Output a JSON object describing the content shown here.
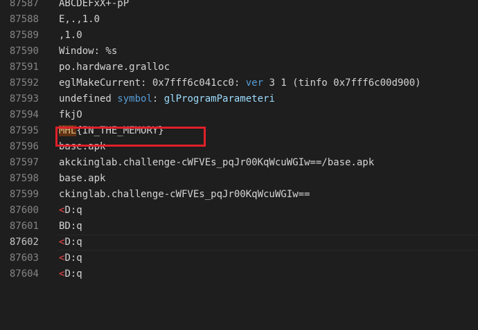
{
  "partial_top_line": "ABCDEFxX+-pP",
  "lines": [
    {
      "num": "87587",
      "text": "ABCDEFxX+-pP"
    },
    {
      "num": "87588",
      "text": "E,.,1.0"
    },
    {
      "num": "87589",
      "text": ",1.0"
    },
    {
      "num": "87590",
      "text": "Window: %s"
    },
    {
      "num": "87591",
      "text": "po.hardware.gralloc"
    },
    {
      "num": "87592",
      "pre": "eglMakeCurrent: 0x7fff6c041cc0: ",
      "kw": "ver",
      "post": " 3 1 (tinfo 0x7fff6c00d900)"
    },
    {
      "num": "87593",
      "pre": "undefined ",
      "kw": "symbol",
      "mid": ": ",
      "fn": "glProgramParameteri"
    },
    {
      "num": "87594",
      "text": "fkjO"
    },
    {
      "num": "87595",
      "hl": "MHL",
      "post": "{IN_THE_MEMORY}"
    },
    {
      "num": "87596",
      "text": "base.apk"
    },
    {
      "num": "87597",
      "text": "akckinglab.challenge-cWFVEs_pqJr00KqWcuWGIw==/base.apk"
    },
    {
      "num": "87598",
      "text": "base.apk"
    },
    {
      "num": "87599",
      "text": "ckinglab.challenge-cWFVEs_pqJr00KqWcuWGIw=="
    },
    {
      "num": "87600",
      "lt": "<",
      "post": "D:q"
    },
    {
      "num": "87601",
      "text": "BD:q"
    },
    {
      "num": "87602",
      "lt": "<",
      "post": "D:q"
    },
    {
      "num": "87603",
      "lt": "<",
      "post": "D:q"
    },
    {
      "num": "87604",
      "lt": "<",
      "post": "D:q"
    }
  ],
  "active_line": "87602",
  "colors": {
    "background": "#1e1e1e",
    "line_number": "#858585",
    "keyword": "#569cd6",
    "identifier": "#9cdcfe",
    "control_char": "#f44747",
    "annotation_box": "#e0202a"
  }
}
